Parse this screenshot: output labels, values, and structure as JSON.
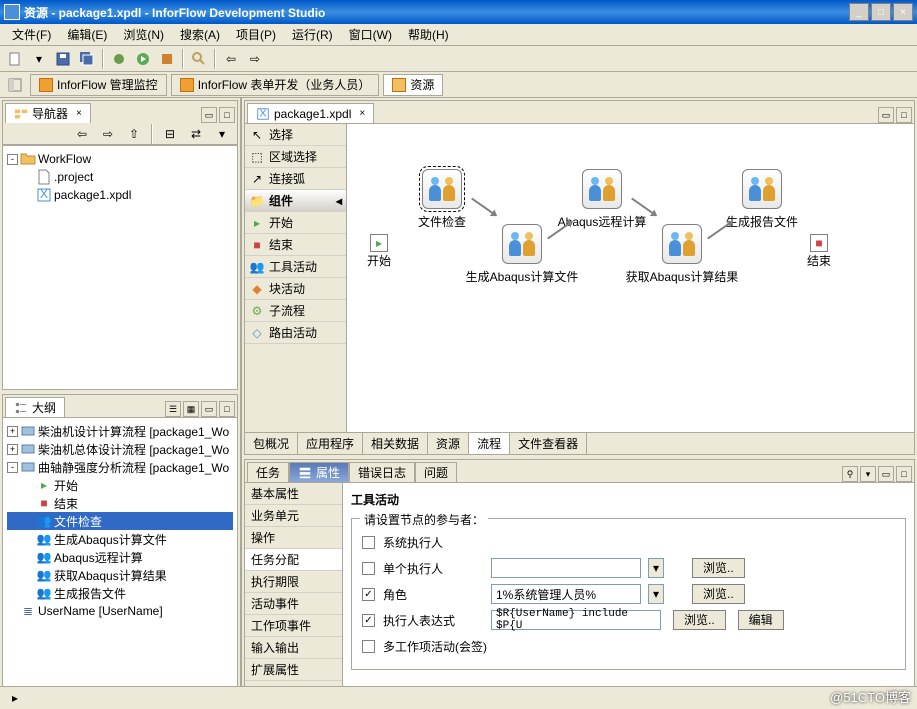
{
  "title": "资源 - package1.xpdl - InforFlow Development Studio",
  "menus": [
    "文件(F)",
    "编辑(E)",
    "浏览(N)",
    "搜索(A)",
    "项目(P)",
    "运行(R)",
    "窗口(W)",
    "帮助(H)"
  ],
  "perspectives": {
    "monitor": "InforFlow 管理监控",
    "formdev": "InforFlow 表单开发（业务人员）",
    "resource": "资源"
  },
  "navigator": {
    "title": "导航器",
    "root": "WorkFlow",
    "items": [
      ".project",
      "package1.xpdl"
    ]
  },
  "outline": {
    "title": "大纲",
    "items": [
      "柴油机设计计算流程 [package1_Wo",
      "柴油机总体设计流程 [package1_Wo",
      "曲轴静强度分析流程 [package1_Wo"
    ],
    "subitems": [
      "开始",
      "结束",
      "文件检查",
      "生成Abaqus计算文件",
      "Abaqus远程计算",
      "获取Abaqus计算结果",
      "生成报告文件"
    ],
    "var": "UserName [UserName]"
  },
  "editor": {
    "tab": "package1.xpdl",
    "palette": {
      "select": "选择",
      "region": "区域选择",
      "connect": "连接弧",
      "group": "组件",
      "start": "开始",
      "end": "结束",
      "tool": "工具活动",
      "block": "块活动",
      "sub": "子流程",
      "route": "路由活动"
    },
    "nodes": {
      "start": "开始",
      "end": "结束",
      "filecheck": "文件检查",
      "genabaqus": "生成Abaqus计算文件",
      "abaqusremote": "Abaqus远程计算",
      "getresult": "获取Abaqus计算结果",
      "genreport": "生成报告文件"
    },
    "bottomtabs": [
      "包概况",
      "应用程序",
      "相关数据",
      "资源",
      "流程",
      "文件查看器"
    ]
  },
  "bottomview": {
    "tabs": [
      "任务",
      "属性",
      "错误日志",
      "问题"
    ],
    "sidecats": [
      "基本属性",
      "业务单元",
      "操作",
      "任务分配",
      "执行期限",
      "活动事件",
      "工作项事件",
      "输入输出",
      "扩展属性"
    ],
    "title": "工具活动",
    "legend": "请设置节点的参与者：",
    "rows": {
      "sysexec": "系统执行人",
      "single": "单个执行人",
      "role": "角色",
      "rolevalue": "1%系统管理人员%",
      "expr": "执行人表达式",
      "exprvalue": "$R{UserName} include $P{U",
      "multi": "多工作项活动(会签)"
    },
    "browse": "浏览..",
    "edit": "编辑"
  },
  "watermark": "@51CTO博客"
}
